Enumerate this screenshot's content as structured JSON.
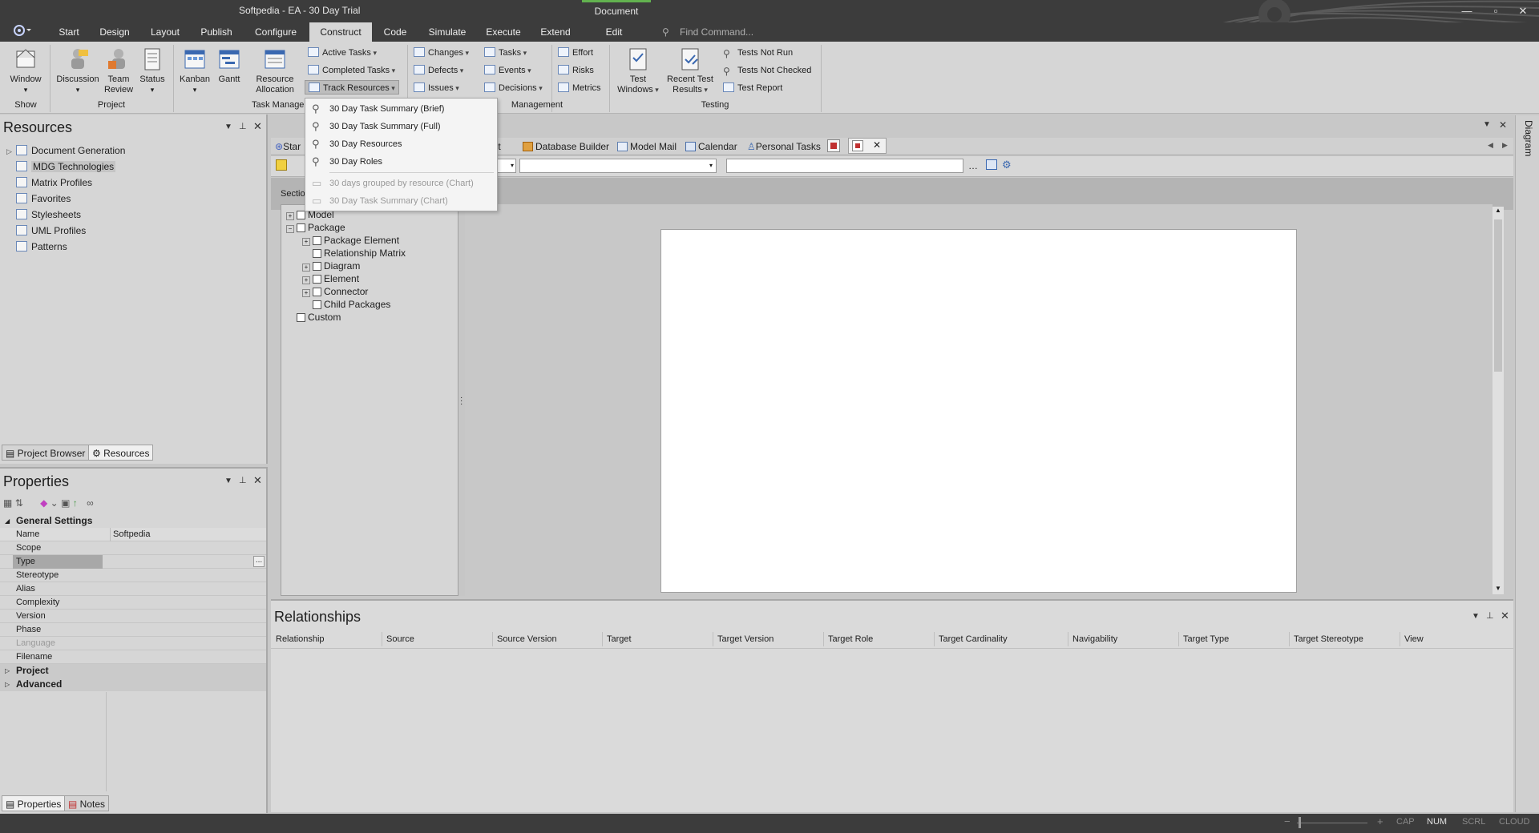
{
  "window": {
    "title": "Softpedia - EA - 30 Day Trial",
    "context_tab": "Document",
    "controls": [
      "—",
      "▫",
      "✕"
    ]
  },
  "menu": {
    "app_icon": "ea-logo-icon",
    "items": [
      "Start",
      "Design",
      "Layout",
      "Publish",
      "Configure",
      "Construct",
      "Code",
      "Simulate",
      "Execute",
      "Extend",
      "Edit"
    ],
    "active": "Construct",
    "find_placeholder": "Find Command..."
  },
  "ribbon": {
    "show": {
      "window_label": "Window",
      "group_label": "Show"
    },
    "project": {
      "discussion": "Discussion",
      "team_review_line1": "Team",
      "team_review_line2": "Review",
      "status": "Status",
      "group_label": "Project"
    },
    "task_management": {
      "kanban": "Kanban",
      "gantt": "Gantt",
      "resource_alloc_line1": "Resource",
      "resource_alloc_line2": "Allocation",
      "active_tasks": "Active Tasks",
      "completed_tasks": "Completed Tasks",
      "track_resources": "Track Resources",
      "group_label": "Task Manage"
    },
    "change_management": {
      "changes": "Changes",
      "defects": "Defects",
      "issues": "Issues",
      "tasks": "Tasks",
      "events": "Events",
      "decisions": "Decisions",
      "effort": "Effort",
      "risks": "Risks",
      "metrics": "Metrics",
      "group_label": "Management"
    },
    "testing": {
      "test_windows_line1": "Test",
      "test_windows_line2": "Windows",
      "recent_results_line1": "Recent Test",
      "recent_results_line2": "Results",
      "tests_not_run": "Tests Not Run",
      "tests_not_checked": "Tests Not Checked",
      "test_report": "Test Report",
      "group_label": "Testing"
    }
  },
  "dropdown": {
    "items": [
      {
        "label": "30 Day Task Summary (Brief)",
        "enabled": true
      },
      {
        "label": "30 Day Task Summary (Full)",
        "enabled": true
      },
      {
        "label": "30 Day Resources",
        "enabled": true
      },
      {
        "label": "30 Day Roles",
        "enabled": true
      },
      {
        "label": "30 days grouped by resource (Chart)",
        "enabled": false
      },
      {
        "label": "30 Day Task Summary (Chart)",
        "enabled": false
      }
    ]
  },
  "resources": {
    "title": "Resources",
    "items": [
      "Document Generation",
      "MDG Technologies",
      "Matrix Profiles",
      "Favorites",
      "Stylesheets",
      "UML Profiles",
      "Patterns"
    ],
    "selected": "MDG Technologies",
    "tabs": [
      "Project Browser",
      "Resources"
    ]
  },
  "properties": {
    "title": "Properties",
    "categories": [
      "General Settings",
      "Project",
      "Advanced"
    ],
    "rows": [
      {
        "name": "Name",
        "value": "Softpedia"
      },
      {
        "name": "Scope",
        "value": ""
      },
      {
        "name": "Type",
        "value": ""
      },
      {
        "name": "Stereotype",
        "value": ""
      },
      {
        "name": "Alias",
        "value": ""
      },
      {
        "name": "Complexity",
        "value": ""
      },
      {
        "name": "Version",
        "value": ""
      },
      {
        "name": "Phase",
        "value": ""
      },
      {
        "name": "Language",
        "value": ""
      },
      {
        "name": "Filename",
        "value": ""
      }
    ],
    "type_button": "...",
    "tabs": [
      "Properties",
      "Notes"
    ]
  },
  "doc_tabs": [
    "Star",
    "ject",
    "Database Builder",
    "Model Mail",
    "Calendar",
    "Personal Tasks"
  ],
  "sections": {
    "label": "Sectio",
    "tree": [
      {
        "label": "Model",
        "level": 0
      },
      {
        "label": "Package",
        "level": 0
      },
      {
        "label": "Package Element",
        "level": 1
      },
      {
        "label": "Relationship Matrix",
        "level": 1
      },
      {
        "label": "Diagram",
        "level": 1
      },
      {
        "label": "Element",
        "level": 1
      },
      {
        "label": "Connector",
        "level": 1
      },
      {
        "label": "Child Packages",
        "level": 1
      },
      {
        "label": "Custom",
        "level": 0
      }
    ]
  },
  "relationships": {
    "title": "Relationships",
    "columns": [
      "Relationship",
      "Source",
      "Source Version",
      "Target",
      "Target Version",
      "Target Role",
      "Target Cardinality",
      "Navigability",
      "Target Type",
      "Target Stereotype",
      "View"
    ]
  },
  "side_tab": "Diagram",
  "status": {
    "zoom_minus": "−",
    "zoom_plus": "+",
    "items": [
      "CAP",
      "NUM",
      "SCRL",
      "CLOUD"
    ]
  }
}
